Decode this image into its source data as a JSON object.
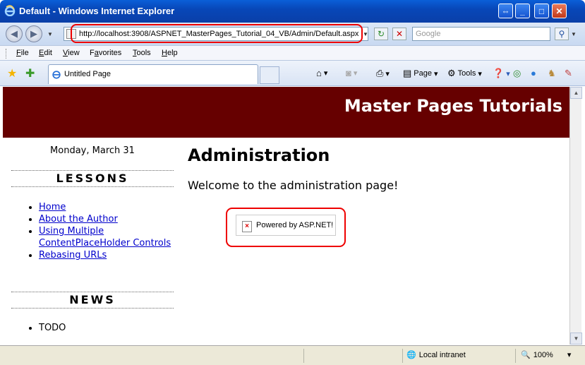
{
  "window": {
    "title": "Default - Windows Internet Explorer",
    "controls": {
      "restore": "⇔",
      "minimize": "_",
      "maximize": "□",
      "close": "✕"
    }
  },
  "address_bar": {
    "url": "http://localhost:3908/ASPNET_MasterPages_Tutorial_04_VB/Admin/Default.aspx",
    "search_placeholder": "Google",
    "refresh_glyph": "↻",
    "stop_glyph": "✕",
    "search_glyph": "⚲"
  },
  "menu": {
    "items": [
      "File",
      "Edit",
      "View",
      "Favorites",
      "Tools",
      "Help"
    ],
    "shortcuts": [
      "F",
      "E",
      "V",
      "a",
      "T",
      "H"
    ]
  },
  "tabs": {
    "active_tab_label": "Untitled Page"
  },
  "command_bar": {
    "page_label": "Page",
    "tools_label": "Tools"
  },
  "page": {
    "banner_title": "Master Pages Tutorials",
    "date": "Monday, March 31",
    "lessons_heading": "LESSONS",
    "lessons": [
      {
        "label": "Home"
      },
      {
        "label": "About the Author"
      },
      {
        "label": "Using Multiple ContentPlaceHolder Controls"
      },
      {
        "label": "Rebasing URLs"
      }
    ],
    "news_heading": "NEWS",
    "news": [
      "TODO"
    ],
    "main_heading": "Administration",
    "welcome_text": "Welcome to the administration page!",
    "powered_image_alt": "Powered by ASP.NET!"
  },
  "status_bar": {
    "zone": "Local intranet",
    "zoom": "100%"
  },
  "colors": {
    "banner": "#660000",
    "link": "#0000cc",
    "highlight": "#ee0000"
  }
}
